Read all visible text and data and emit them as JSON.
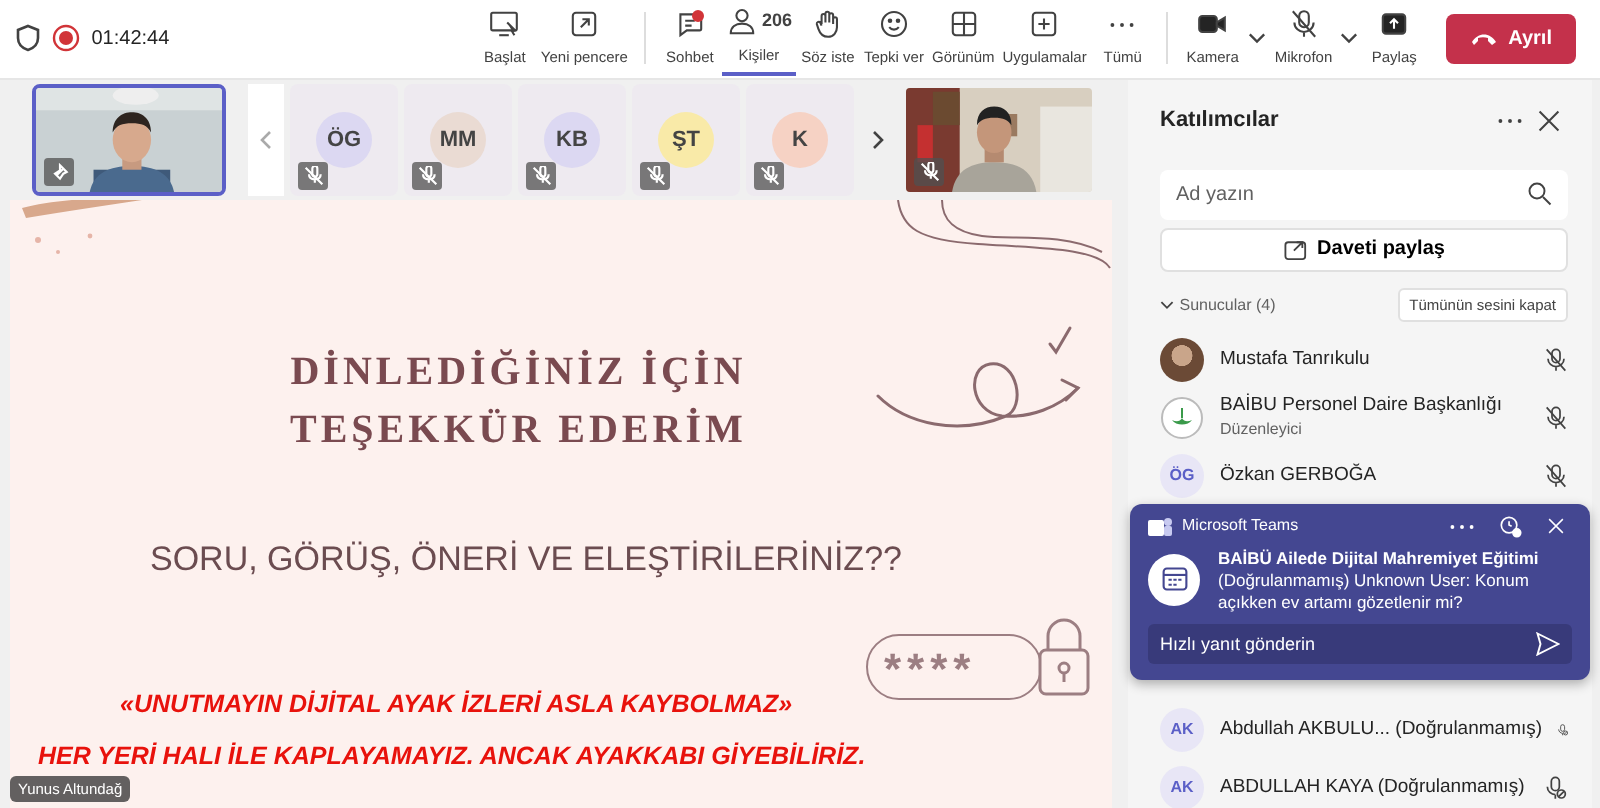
{
  "top_bar": {
    "recording": true,
    "time": "01:42:44",
    "tool_groups": [
      [
        {
          "label": "Başlat",
          "selected": false
        },
        {
          "label": "Yeni pencere",
          "selected": false
        }
      ],
      [
        {
          "label": "Sohbet",
          "selected": false,
          "unread": true
        },
        {
          "label": "Kişiler",
          "count": "206",
          "selected": true
        },
        {
          "label": "Söz iste",
          "selected": false
        },
        {
          "label": "Tepki ver",
          "selected": false
        },
        {
          "label": "Görünüm",
          "selected": false
        },
        {
          "label": "Uygulamalar",
          "selected": false
        },
        {
          "label": "Tümü",
          "selected": false
        }
      ],
      [
        {
          "label": "Kamera",
          "selected": false,
          "menu": true
        },
        {
          "label": "Mikrofon",
          "selected": false,
          "menu": true
        },
        {
          "label": "Paylaş",
          "selected": false
        }
      ]
    ],
    "leave_button": "Ayrıl"
  },
  "video_strip": {
    "tiles": [
      {
        "kind": "video",
        "selected": true
      },
      {
        "kind": "avatar",
        "initials": "ÖG",
        "color": "#dcd8f2",
        "muted": true
      },
      {
        "kind": "avatar",
        "initials": "MM",
        "color": "#eadbd3",
        "muted": true
      },
      {
        "kind": "avatar",
        "initials": "KB",
        "color": "#dcd8f2",
        "muted": true
      },
      {
        "kind": "avatar",
        "initials": "ŞT",
        "color": "#f9eaa8",
        "muted": true
      },
      {
        "kind": "avatar",
        "initials": "K",
        "color": "#f6d2c4",
        "muted": true
      },
      {
        "kind": "video",
        "selected": false,
        "muted": true
      }
    ]
  },
  "slide": {
    "title": [
      "DİNLEDİĞİNİZ İÇİN",
      "TEŞEKKÜR EDERİM"
    ],
    "question": "SORU, GÖRÜŞ, ÖNERİ VE ELEŞTİRİLERİNİZ??",
    "password": "****",
    "quote": "«UNUTMAYIN DİJİTAL AYAK İZLERİ ASLA KAYBOLMAZ»",
    "saying": "HER YERİ HALI İLE KAPLAYAMAYIZ. ANCAK AYAKKABI GİYEBİLİRİZ.",
    "presenter": "Yunus Altundağ"
  },
  "participants_panel": {
    "title": "Katılımcılar",
    "search": {
      "placeholder": "Ad yazın"
    },
    "share_button": "Daveti paylaş",
    "section": {
      "label": "Sunucular (4)",
      "expanded": true,
      "mute_all_button": "Tümünün sesini kapat"
    },
    "presenters": [
      {
        "name": "Mustafa Tanrıkulu",
        "muted": true
      },
      {
        "kind": "logo",
        "name": "BAİBU Personel Daire Başkanlığı",
        "role": "Düzenleyici",
        "muted": true
      },
      {
        "kind": "initials",
        "initials": "ÖG",
        "name": "Özkan GERBOĞA",
        "muted": true
      }
    ],
    "attendees": [
      {
        "initials": "AK",
        "name": "Abdullah AKBULU... (Doğrulanmamış)"
      },
      {
        "initials": "AK",
        "name": "ABDULLAH KAYA (Doğrulanmamış)"
      }
    ]
  },
  "notification": {
    "app": "Microsoft Teams",
    "title": "BAİBÜ Ailede Dijital Mahremiyet Eğitimi",
    "message": "(Doğrulanmamış) Unknown User: Konum açıkken ev artamı gözetlenir mi?",
    "reply": {
      "placeholder": "Hızlı yanıt gönderin"
    }
  }
}
